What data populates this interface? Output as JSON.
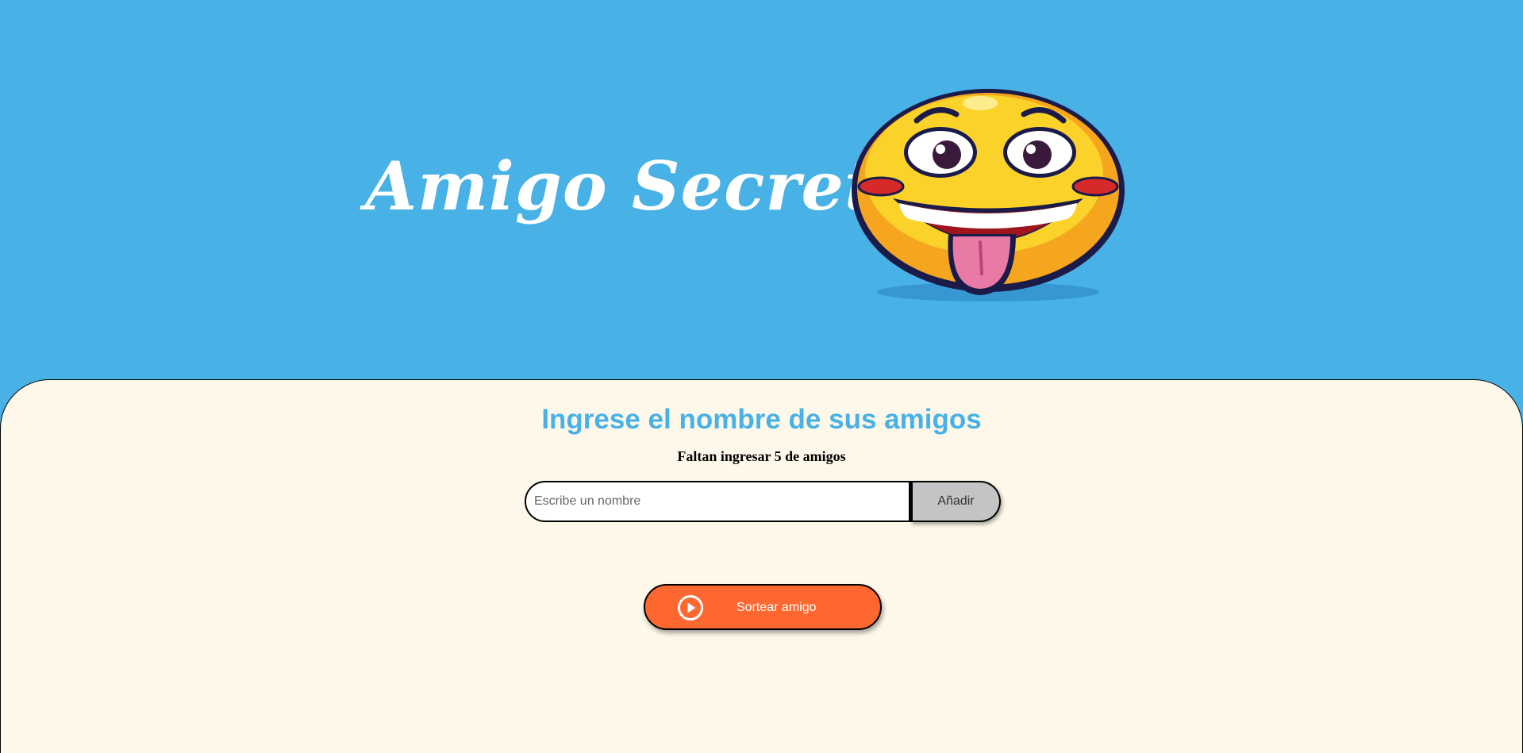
{
  "header": {
    "title": "Amigo Secreto",
    "mascot_icon": "laughing-tongue-out-emoji"
  },
  "main": {
    "section_title": "Ingrese el nombre de sus amigos",
    "status_text": "Faltan ingresar 5 de amigos",
    "name_input": {
      "value": "",
      "placeholder": "Escribe un nombre"
    },
    "add_button_label": "Añadir",
    "draw_button_label": "Sortear amigo",
    "draw_button_icon": "play-circle-icon"
  },
  "colors": {
    "header_background": "#48b1e6",
    "panel_background": "#fef8ea",
    "title_accent": "#48b1e6",
    "draw_button": "#ff6730",
    "add_button": "#c4c4c4"
  }
}
